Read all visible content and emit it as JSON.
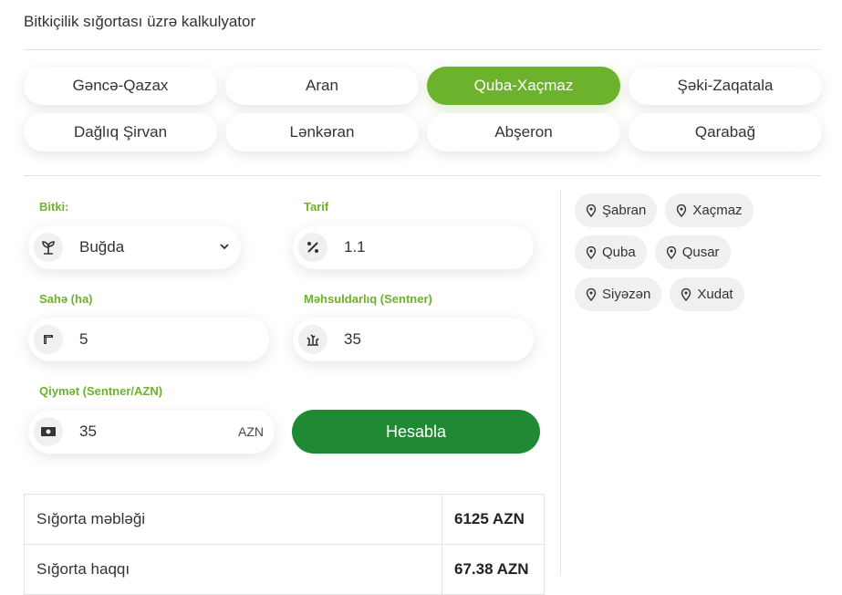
{
  "page": {
    "title": "Bitkiçilik sığortası üzrə kalkulyator"
  },
  "regions": [
    {
      "label": "Gəncə-Qazax",
      "active": false
    },
    {
      "label": "Aran",
      "active": false
    },
    {
      "label": "Quba-Xaçmaz",
      "active": true
    },
    {
      "label": "Şəki-Zaqatala",
      "active": false
    },
    {
      "label": "Dağlıq Şirvan",
      "active": false
    },
    {
      "label": "Lənkəran",
      "active": false
    },
    {
      "label": "Abşeron",
      "active": false
    },
    {
      "label": "Qarabağ",
      "active": false
    }
  ],
  "form": {
    "crop": {
      "label": "Bitki:",
      "value": "Buğda",
      "icon": "plant-icon"
    },
    "tariff": {
      "label": "Tarif",
      "value": "1.1",
      "icon": "percent-icon"
    },
    "area": {
      "label": "Sahə (ha)",
      "value": "5",
      "icon": "ruler-icon"
    },
    "yield": {
      "label": "Məhsuldarlıq (Sentner)",
      "value": "35",
      "icon": "yield-icon"
    },
    "price": {
      "label": "Qiymət (Sentner/AZN)",
      "value": "35",
      "unit": "AZN",
      "icon": "money-icon"
    },
    "submit_label": "Hesabla"
  },
  "towns": [
    [
      "Şabran",
      "Xaçmaz"
    ],
    [
      "Quba",
      "Qusar"
    ],
    [
      "Siyəzən",
      "Xudat"
    ]
  ],
  "results": [
    {
      "label": "Sığorta məbləği",
      "value": "6125 AZN"
    },
    {
      "label": "Sığorta haqqı",
      "value": "67.38 AZN"
    }
  ],
  "colors": {
    "accent": "#6cb22d",
    "button": "#1f8a33",
    "label": "#6cb22d"
  }
}
